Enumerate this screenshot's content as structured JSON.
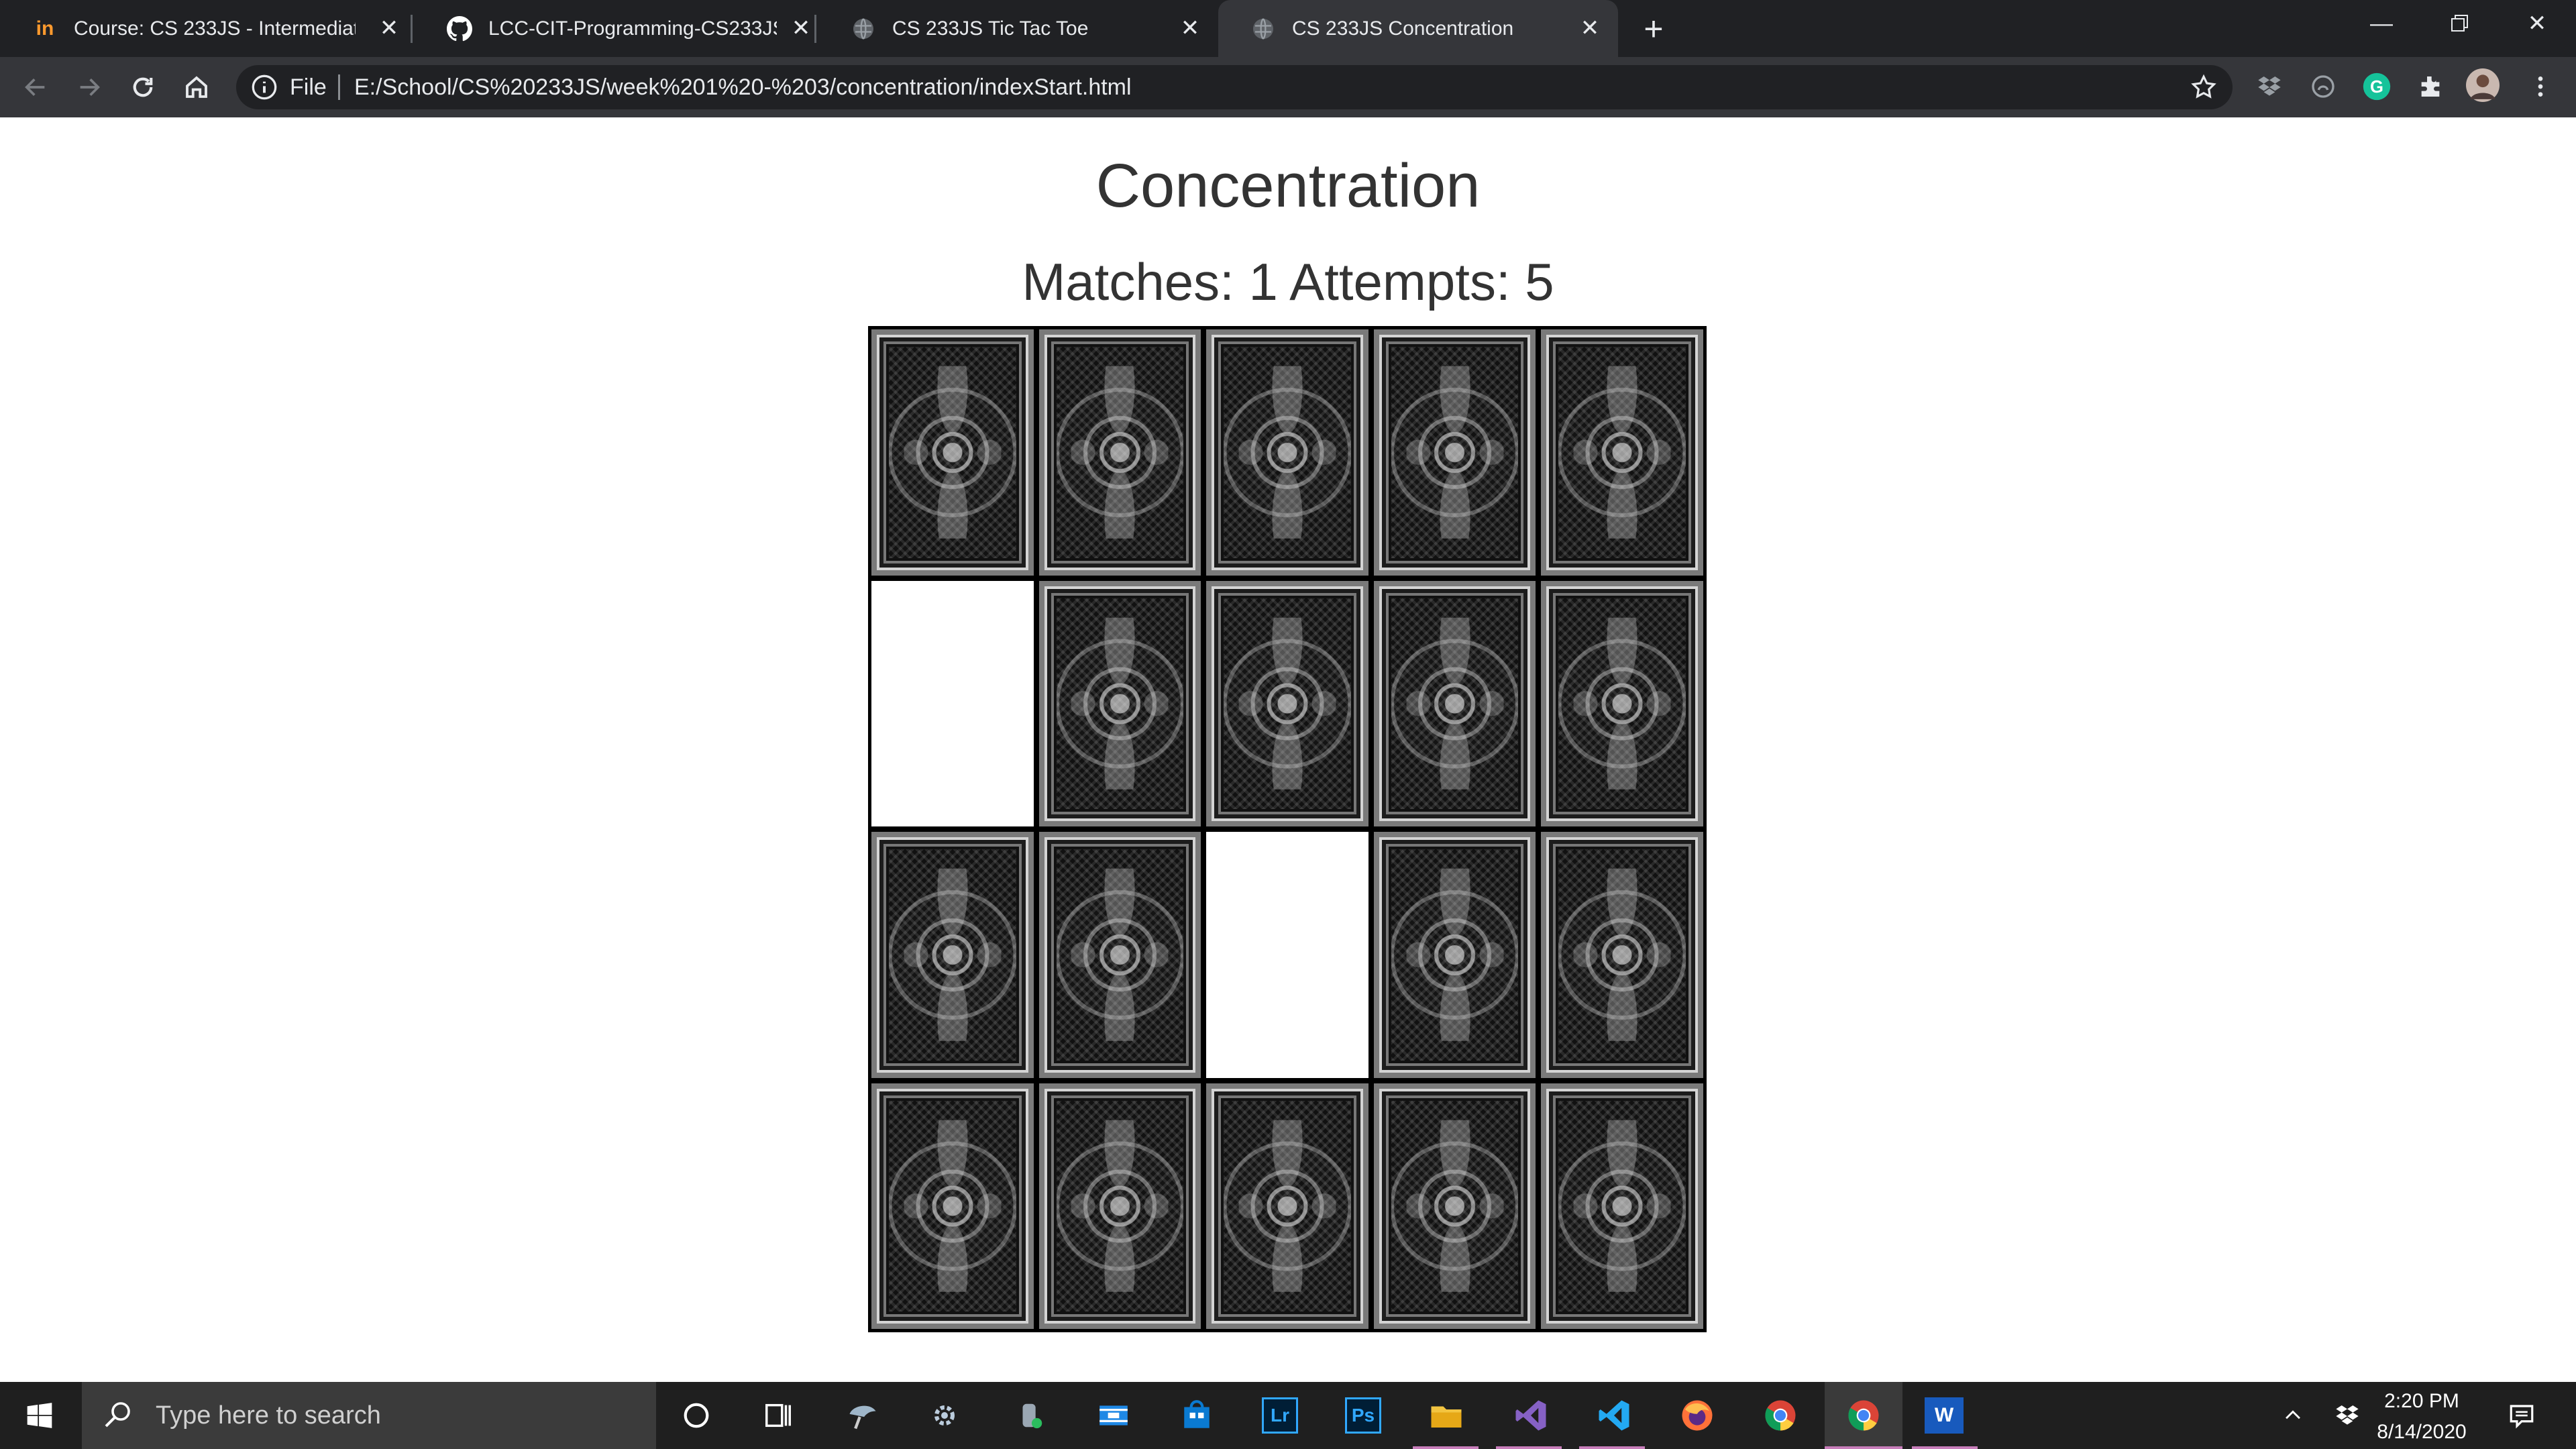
{
  "browser": {
    "tabs": [
      {
        "title": "Course: CS 233JS - Intermediate P",
        "favicon": "in-logo-icon",
        "active": false
      },
      {
        "title": "LCC-CIT-Programming-CS233JS/",
        "favicon": "github-icon",
        "active": false
      },
      {
        "title": "CS 233JS Tic Tac Toe",
        "favicon": "globe-icon",
        "active": false
      },
      {
        "title": "CS 233JS Concentration",
        "favicon": "globe-icon",
        "active": true
      }
    ],
    "scheme_label": "File",
    "url": "E:/School/CS%20233JS/week%201%20-%203/concentration/indexStart.html"
  },
  "page": {
    "title": "Concentration",
    "score": "Matches: 1 Attempts: 5",
    "board": {
      "rows": 4,
      "cols": 5,
      "cells": [
        "back",
        "back",
        "back",
        "back",
        "back",
        "empty",
        "back",
        "back",
        "back",
        "back",
        "back",
        "back",
        "empty",
        "back",
        "back",
        "back",
        "back",
        "back",
        "back",
        "back"
      ]
    }
  },
  "taskbar": {
    "search_placeholder": "Type here to search",
    "apps": [
      "cortana-icon",
      "task-view-icon",
      "app-icon",
      "settings-icon",
      "app-icon",
      "film-icon",
      "store-icon",
      "lightroom-icon",
      "photoshop-icon",
      "file-explorer-icon",
      "visual-studio-icon",
      "vscode-icon",
      "firefox-icon",
      "chrome-icon",
      "chrome-icon",
      "word-icon"
    ],
    "lightroom_label": "Lr",
    "photoshop_label": "Ps",
    "word_label": "W",
    "time": "2:20 PM",
    "date": "8/14/2020"
  },
  "colors": {
    "tabstrip": "#202124",
    "toolbar": "#35363a",
    "text_dark": "#333333",
    "taskbar": "#1f1f1f",
    "grammarly": "#15c39a"
  }
}
